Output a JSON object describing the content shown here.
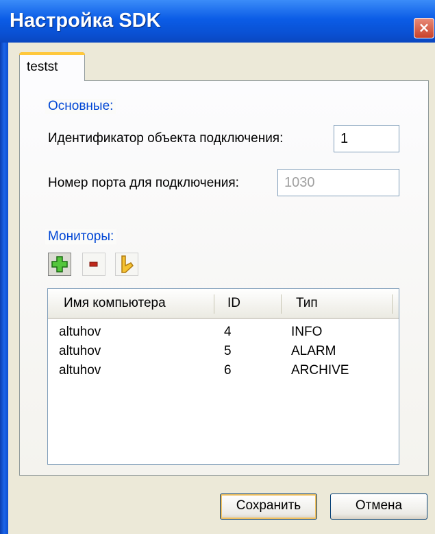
{
  "window": {
    "title": "Настройка SDK",
    "close_glyph": "×",
    "colors": {
      "titlebar": "#0a50d2",
      "close": "#c8422a",
      "accent_tab": "#ffc83c",
      "group_legend": "#0046d5"
    }
  },
  "tabs": [
    {
      "label": "testst",
      "selected": true
    }
  ],
  "main_group": {
    "legend": "Основные:",
    "object_id_label": "Идентификатор объекта подключения:",
    "object_id_value": "1",
    "port_label": "Номер порта для подключения:",
    "port_value": "1030"
  },
  "monitors_group": {
    "legend": "Мониторы:",
    "toolbar": [
      {
        "icon": "add-icon",
        "pressed": true
      },
      {
        "icon": "remove-icon",
        "pressed": false
      },
      {
        "icon": "edit-icon",
        "pressed": false
      }
    ],
    "columns": [
      "Имя компьютера",
      "ID",
      "Тип"
    ],
    "rows": [
      {
        "name": "altuhov",
        "id": "4",
        "type": "INFO"
      },
      {
        "name": "altuhov",
        "id": "5",
        "type": "ALARM"
      },
      {
        "name": "altuhov",
        "id": "6",
        "type": "ARCHIVE"
      }
    ]
  },
  "buttons": {
    "save": "Сохранить",
    "cancel": "Отмена"
  }
}
